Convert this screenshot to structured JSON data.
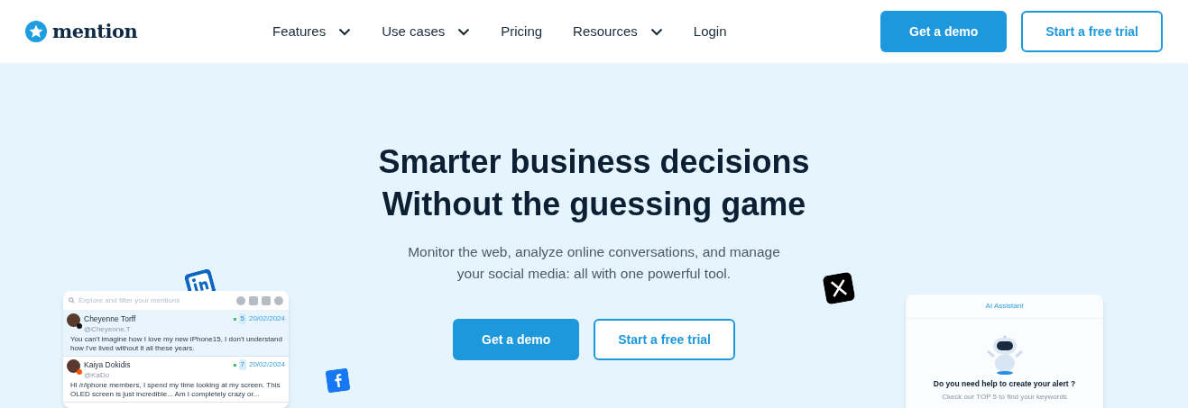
{
  "header": {
    "logo": "mention",
    "nav": [
      {
        "label": "Features",
        "dropdown": true
      },
      {
        "label": "Use cases",
        "dropdown": true
      },
      {
        "label": "Pricing",
        "dropdown": false
      },
      {
        "label": "Resources",
        "dropdown": true
      },
      {
        "label": "Login",
        "dropdown": false
      }
    ],
    "buttons": [
      {
        "label": "Get a demo",
        "kind": "primary"
      },
      {
        "label": "Start a free trial",
        "kind": "outline"
      }
    ]
  },
  "hero": {
    "title_lines": [
      "Smarter business decisions",
      "Without the guessing game"
    ],
    "subtitle_lines": [
      "Monitor the web, analyze online conversations, and manage",
      "your social media: all with one powerful tool."
    ],
    "buttons": [
      {
        "label": "Get a demo",
        "kind": "primary"
      },
      {
        "label": "Start a free trial",
        "kind": "outline"
      }
    ]
  },
  "mentions_card": {
    "search_placeholder": "Explore and filter your mentions",
    "mentions": [
      {
        "name": "Cheyenne Torff",
        "handle": "@Cheyenne.T",
        "count": "5",
        "date": "20/02/2024",
        "text": "You can't imagine how I love my new iPhone15, I don't understand how I've lived without it all these years.",
        "kind": "x",
        "selected": true
      },
      {
        "name": "Kaiya Dokidis",
        "handle": "@KaDo",
        "count": "7",
        "date": "20/02/2024",
        "text": "Hi /r/iphone members, I spend my time looking at my screen. This OLED screen is just incredible... Am I completely crazy or...",
        "kind": "reddit",
        "selected": false
      }
    ]
  },
  "assistant_card": {
    "title": "AI Assistant",
    "question": "Do you need help to create your alert ?",
    "hint": "Ckeck our TOP 5 to find your keywords"
  }
}
